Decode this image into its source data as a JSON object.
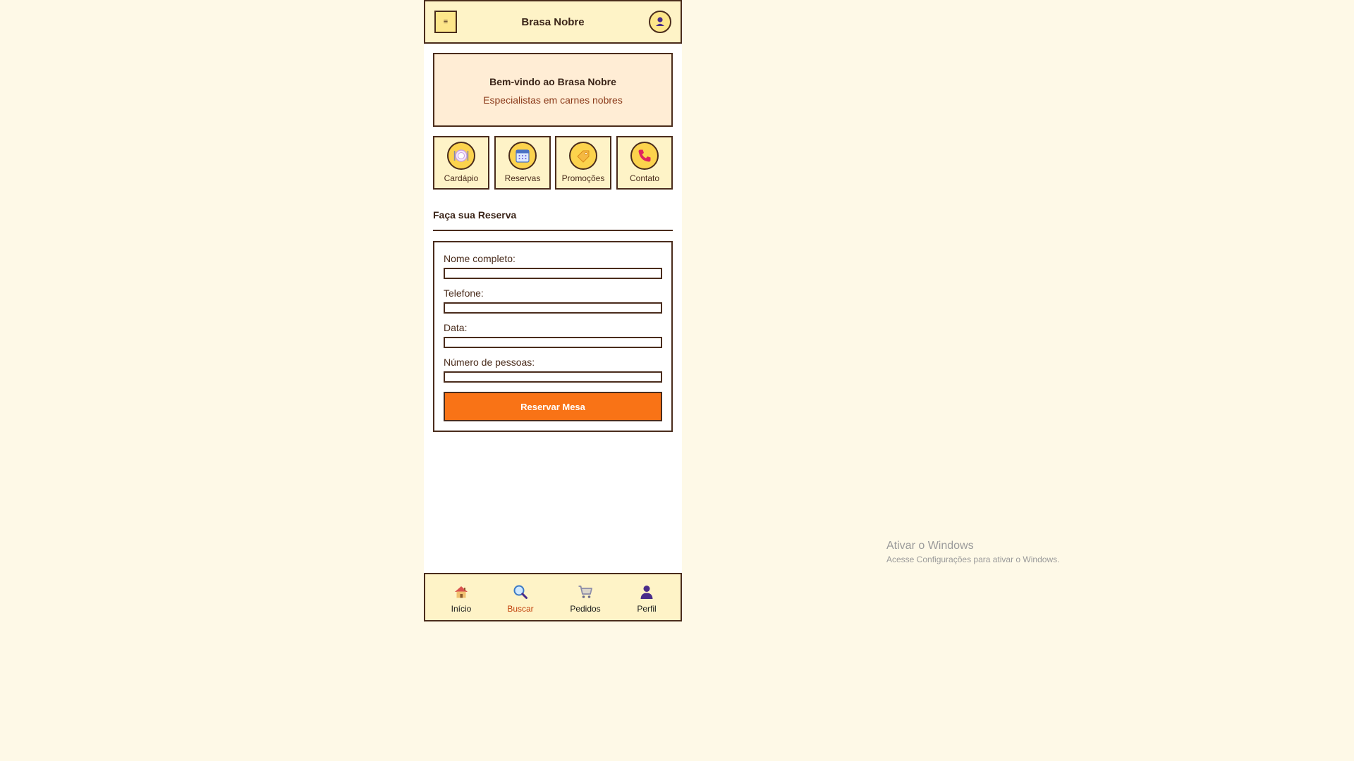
{
  "header": {
    "menu_glyph": "≡",
    "title": "Brasa Nobre"
  },
  "welcome": {
    "title": "Bem-vindo ao Brasa Nobre",
    "subtitle": "Especialistas em carnes nobres"
  },
  "quick_actions": [
    {
      "label": "Cardápio",
      "icon": "plate-icon"
    },
    {
      "label": "Reservas",
      "icon": "calendar-icon"
    },
    {
      "label": "Promoções",
      "icon": "tag-icon"
    },
    {
      "label": "Contato",
      "icon": "phone-icon"
    }
  ],
  "reservation": {
    "title": "Faça sua Reserva",
    "fields": [
      {
        "label": "Nome completo:",
        "value": "",
        "placeholder": ""
      },
      {
        "label": "Telefone:",
        "value": "",
        "placeholder": ""
      },
      {
        "label": "Data:",
        "value": "",
        "placeholder": ""
      },
      {
        "label": "Número de pessoas:",
        "value": "",
        "placeholder": ""
      }
    ],
    "submit_label": "Reservar Mesa"
  },
  "bottom_nav": [
    {
      "label": "Início",
      "icon": "home-icon",
      "active": false
    },
    {
      "label": "Buscar",
      "icon": "search-icon",
      "active": true
    },
    {
      "label": "Pedidos",
      "icon": "cart-icon",
      "active": false
    },
    {
      "label": "Perfil",
      "icon": "person-icon",
      "active": false
    }
  ],
  "watermark": {
    "title": "Ativar o Windows",
    "subtitle": "Acesse Configurações para ativar o Windows."
  },
  "colors": {
    "page_background": "#fef9e7",
    "header_background": "#fef3c7",
    "border": "#4a2c1c",
    "accent": "#f97316",
    "active_nav": "#c2410c",
    "welcome_background": "#ffedd5"
  }
}
